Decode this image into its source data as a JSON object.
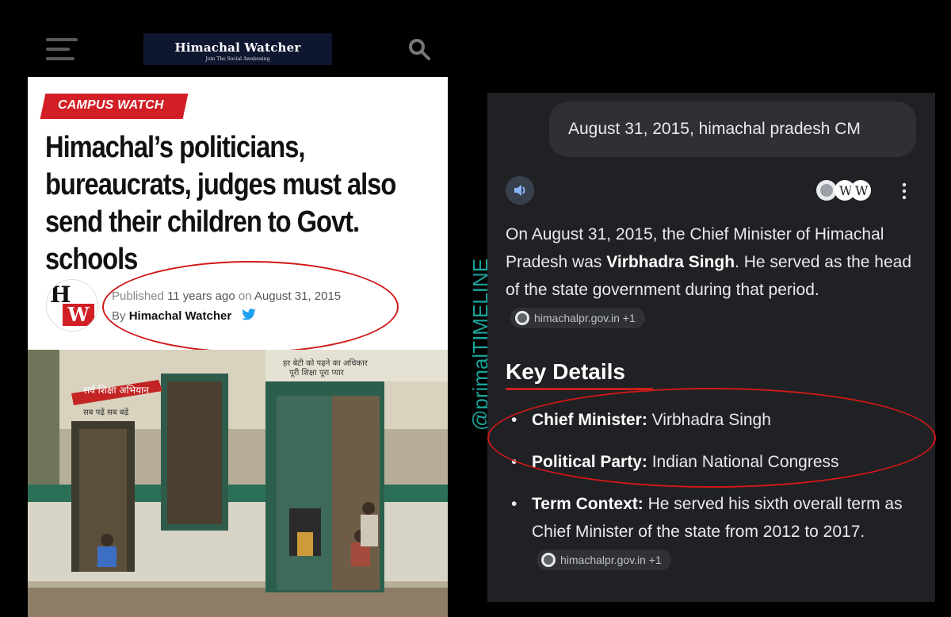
{
  "site": {
    "logo_text": "Himachal Watcher",
    "logo_tagline": "Join The Social Awakening"
  },
  "article": {
    "category": "CAMPUS WATCH",
    "headline": "Himachal’s politicians, bureaucrats, judges must also send their children to Govt. schools",
    "published_prefix": "Published",
    "published_age": "11 years ago",
    "published_on": "on",
    "published_date": "August 31, 2015",
    "by_prefix": "By",
    "author": "Himachal Watcher",
    "avatar_letters": [
      "H",
      "W"
    ],
    "photo_wall_text_1": "सर्व शिक्षा अभियान",
    "photo_wall_text_2": "सब पढ़ें सब बढ़ें",
    "photo_wall_text_3": "हर बेटी को पढ़ने का अधिकार",
    "photo_wall_text_4": "पूरी शिक्षा पूरा प्यार"
  },
  "watermark": "@primalTIMELINE",
  "ai_card": {
    "query": "August 31, 2015, himachal pradesh CM",
    "answer_part1": "On August 31, 2015, the Chief Minister of Himachal Pradesh was ",
    "answer_bold": "Virbhadra Singh",
    "answer_part2": ". He served as the head of the state government during that period.",
    "source_chip_1": "himachalpr.gov.in +1",
    "key_details_title": "Key Details",
    "details": [
      {
        "label": "Chief Minister:",
        "value": " Virbhadra Singh"
      },
      {
        "label": "Political Party:",
        "value": " Indian National Congress"
      },
      {
        "label": "Term Context:",
        "value": " He served his sixth overall term as Chief Minister of the state from 2012 to 2017."
      }
    ],
    "source_chip_2": "himachalpr.gov.in +1"
  },
  "colors": {
    "accent_red": "#d21f26",
    "annotation_red": "#d01818",
    "card_bg": "#202124",
    "watermark": "#1aa39a",
    "twitter": "#1da1f2"
  },
  "icons": [
    "menu-icon",
    "search-icon",
    "twitter-icon",
    "speaker-icon",
    "source-logo-icon",
    "wikipedia-icon",
    "more-vert-icon",
    "globe-icon"
  ]
}
